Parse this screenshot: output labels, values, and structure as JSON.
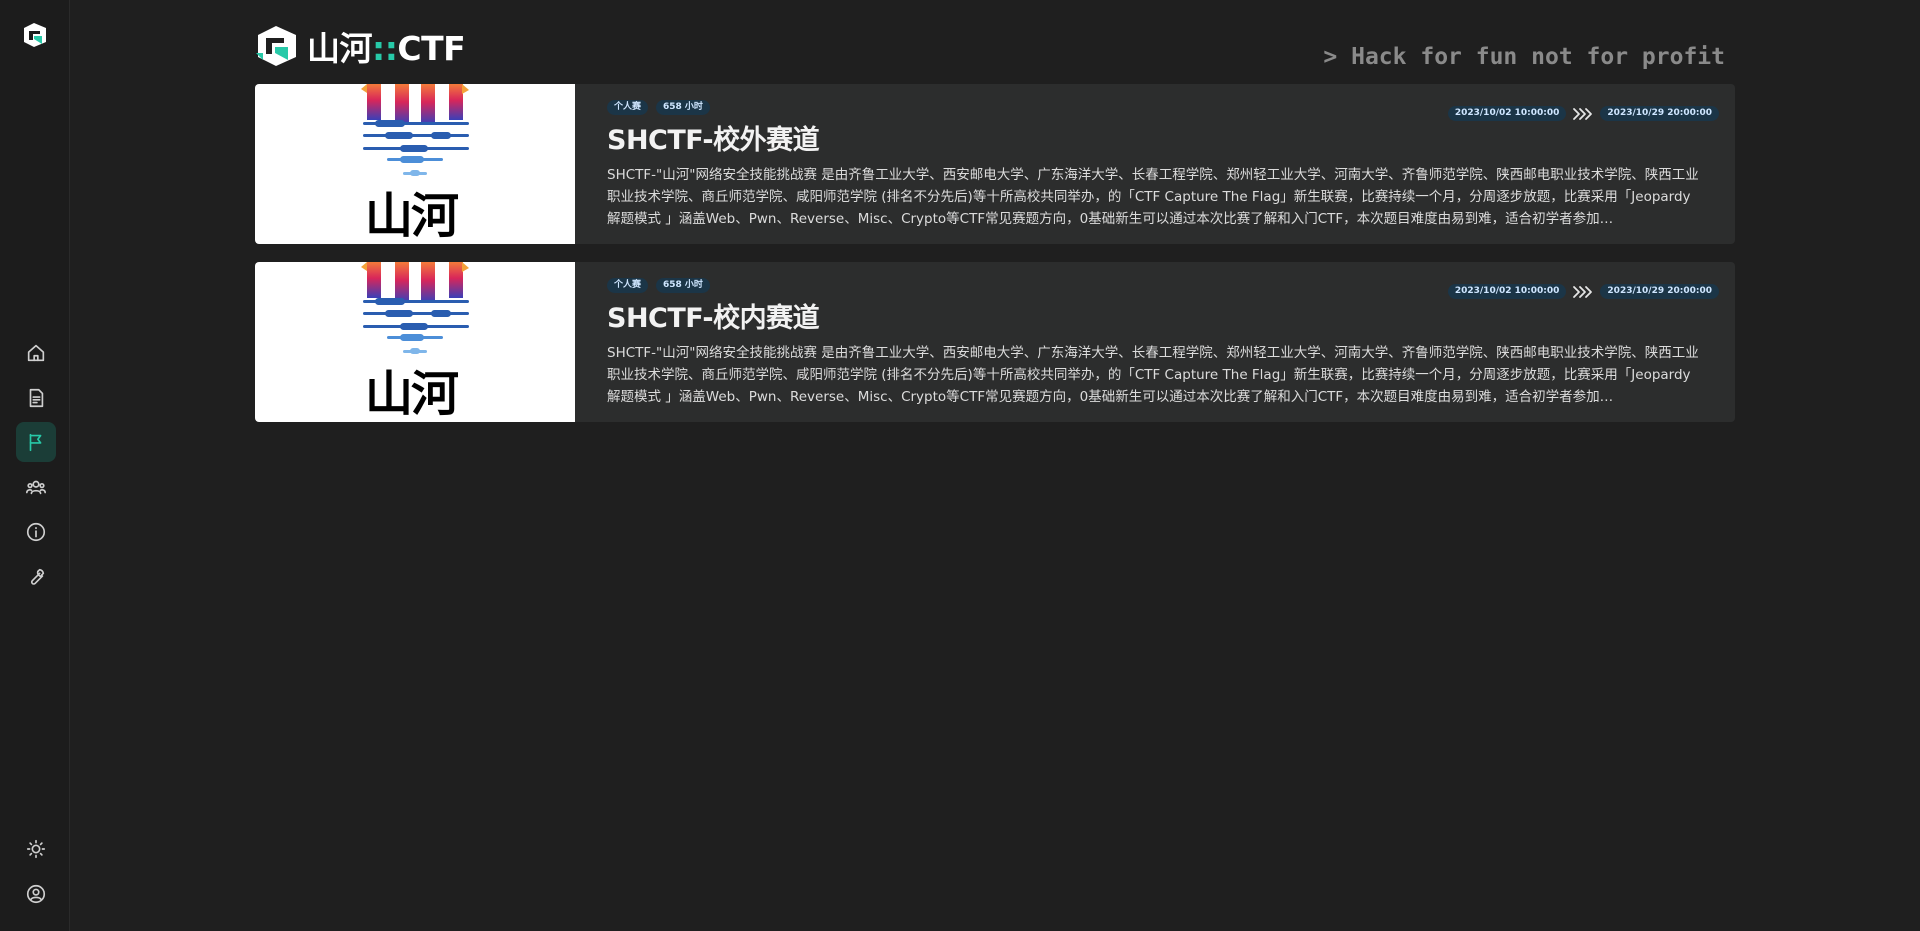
{
  "sidebar": {
    "items": [
      {
        "icon": "home-icon",
        "label": "home"
      },
      {
        "icon": "document-icon",
        "label": "posts"
      },
      {
        "icon": "flag-icon",
        "label": "games",
        "active": true
      },
      {
        "icon": "team-icon",
        "label": "teams"
      },
      {
        "icon": "info-icon",
        "label": "about"
      },
      {
        "icon": "wrench-icon",
        "label": "admin"
      }
    ],
    "bottom": [
      {
        "icon": "theme-toggle-icon"
      },
      {
        "icon": "user-profile-icon"
      }
    ]
  },
  "header": {
    "brand_cn": "山河",
    "brand_sep": "::",
    "brand_ctf": "CTF",
    "slogan": "> Hack for fun not for profit"
  },
  "games": [
    {
      "title": "SHCTF-校外赛道",
      "mode_tag": "个人赛",
      "duration_tag": "658 小时",
      "start": "2023/10/02 10:00:00",
      "end": "2023/10/29 20:00:00",
      "poster_text": "山河",
      "summary": "SHCTF-\"山河\"网络安全技能挑战赛 是由齐鲁工业大学、西安邮电大学、广东海洋大学、长春工程学院、郑州轻工业大学、河南大学、齐鲁师范学院、陕西邮电职业技术学院、陕西工业职业技术学院、商丘师范学院、咸阳师范学院 (排名不分先后)等十所高校共同举办，的「CTF Capture The Flag」新生联赛，比赛持续一个月，分周逐步放题，比赛采用「Jeopardy 解题模式 」涵盖Web、Pwn、Reverse、Misc、Crypto等CTF常见赛题方向，0基础新生可以通过本次比赛了解和入门CTF，本次题目难度由易到难，适合初学者参加…"
    },
    {
      "title": "SHCTF-校内赛道",
      "mode_tag": "个人赛",
      "duration_tag": "658 小时",
      "start": "2023/10/02 10:00:00",
      "end": "2023/10/29 20:00:00",
      "poster_text": "山河",
      "summary": "SHCTF-\"山河\"网络安全技能挑战赛 是由齐鲁工业大学、西安邮电大学、广东海洋大学、长春工程学院、郑州轻工业大学、河南大学、齐鲁师范学院、陕西邮电职业技术学院、陕西工业职业技术学院、商丘师范学院、咸阳师范学院 (排名不分先后)等十所高校共同举办，的「CTF Capture The Flag」新生联赛，比赛持续一个月，分周逐步放题，比赛采用「Jeopardy 解题模式 」涵盖Web、Pwn、Reverse、Misc、Crypto等CTF常见赛题方向，0基础新生可以通过本次比赛了解和入门CTF，本次题目难度由易到难，适合初学者参加…"
    }
  ],
  "colors": {
    "accent": "#27c9a8",
    "background": "#1f1f1f",
    "card": "#2c2d2d",
    "badge": "#1b3547"
  }
}
